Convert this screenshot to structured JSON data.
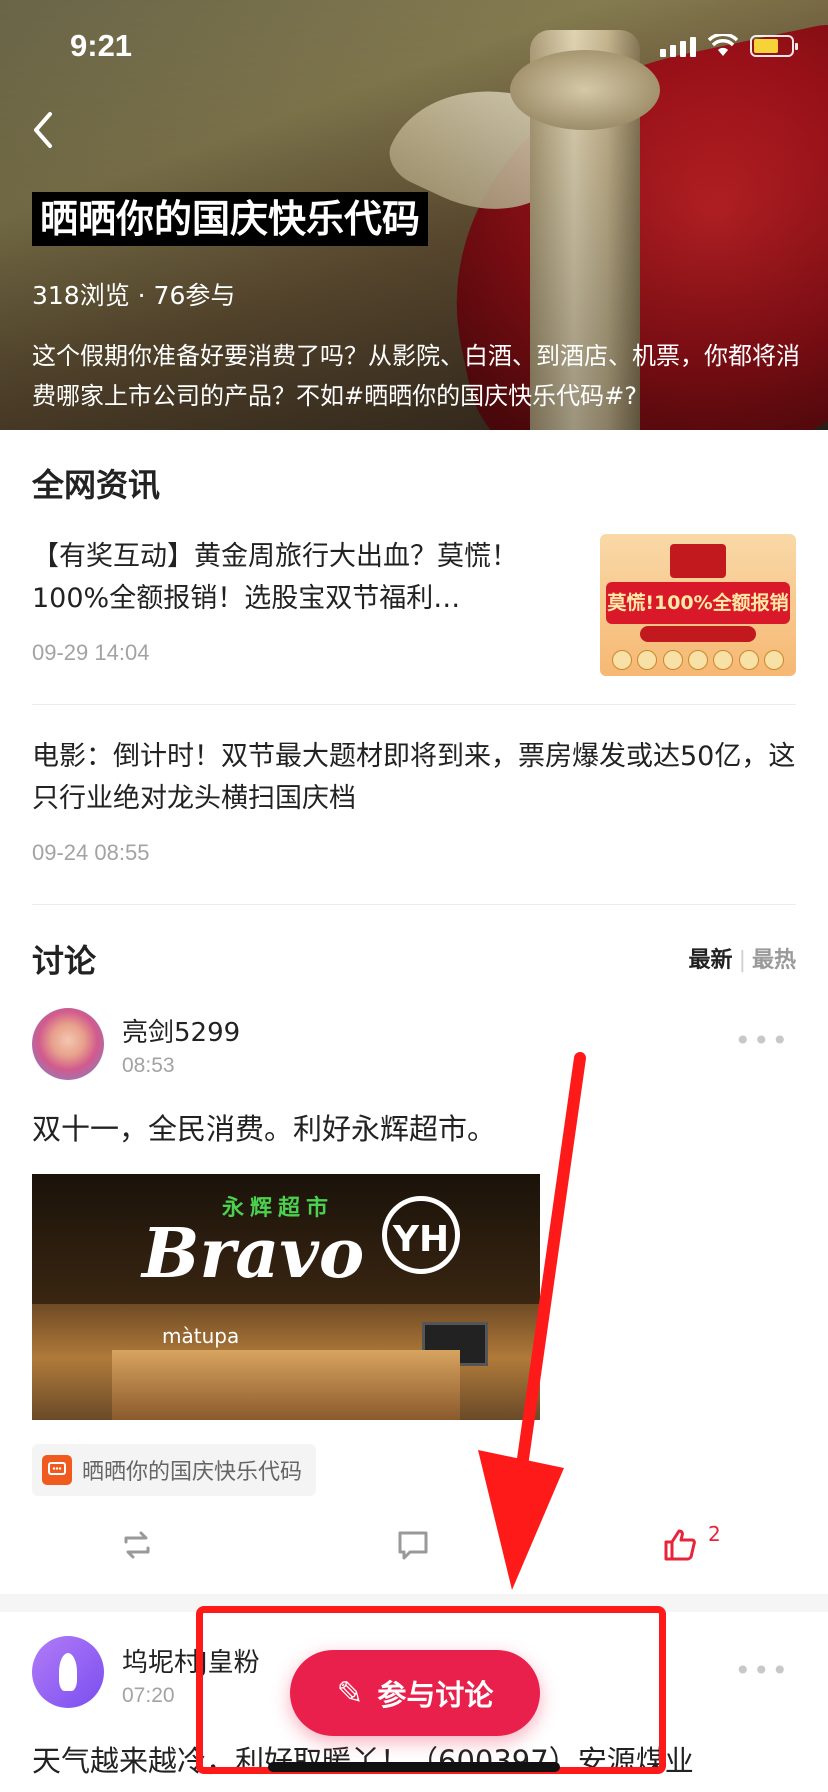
{
  "status_bar": {
    "time": "9:21"
  },
  "hero": {
    "title": "晒晒你的国庆快乐代码",
    "stats": "318浏览 · 76参与",
    "description": "这个假期你准备好要消费了吗？从影院、白酒、到酒店、机票，你都将消费哪家上市公司的产品？不如#晒晒你的国庆快乐代码#?"
  },
  "news": {
    "section_title": "全网资讯",
    "items": [
      {
        "title": "【有奖互动】黄金周旅行大出血？莫慌！100%全额报销！选股宝双节福利…",
        "date": "09-29 14:04",
        "thumb_text": "莫慌!100%全额报销"
      },
      {
        "title": "电影：倒计时！双节最大题材即将到来，票房爆发或达50亿，这只行业绝对龙头横扫国庆档",
        "date": "09-24 08:55"
      }
    ]
  },
  "discussion": {
    "section_title": "讨论",
    "sort_latest": "最新",
    "sort_hot": "最热",
    "posts": [
      {
        "user": "亮剑5299",
        "time": "08:53",
        "text": "双十一，全民消费。利好永辉超市。",
        "image_text": {
          "brand": "Bravo",
          "cn": "永辉超市",
          "logo": "YH",
          "shop": "màtupa"
        },
        "topic": "晒晒你的国庆快乐代码",
        "likes": "2"
      },
      {
        "user": "坞坭村J皇粉",
        "time": "07:20",
        "text": "天气越来越冷，利好取暖丫！（600397）安源煤业"
      }
    ]
  },
  "fab": {
    "label": "参与讨论"
  },
  "colors": {
    "accent": "#e8204b",
    "annotation": "#ff1a1a",
    "topic_icon": "#f05a1f"
  }
}
